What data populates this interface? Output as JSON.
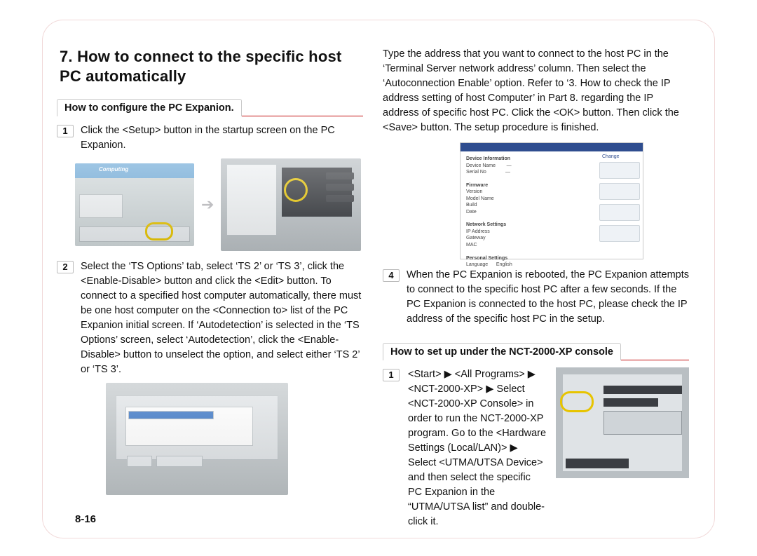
{
  "section_number": "7.",
  "section_title": "How to connect to the specific host PC automatically",
  "subheads": {
    "configure": "How to configure the PC Expanion.",
    "console": "How to set up under the NCT-2000-XP console"
  },
  "left": {
    "step1_num": "1",
    "step1": "Click the <Setup> button in the startup screen on the PC Expanion.",
    "step2_num": "2",
    "step2": "Select the ‘TS Options’ tab, select ‘TS 2’ or ‘TS 3’, click the <Enable-Disable> button and click the <Edit> button. To connect to a specified host computer automatically, there must be one host computer on the <Connection to> list of the PC Expanion initial screen. If ‘Autodetection’ is selected in the ‘TS Options’ screen, select ‘Autodetection’, click the <Enable-Disable> button to unselect the option, and select either ‘TS 2’ or ‘TS 3’."
  },
  "right": {
    "intro": "Type the address that you want to connect to the host PC in the ‘Terminal Server network address’ column. Then select the ‘Autoconnection Enable’ option. Refer to ‘3. How to check the IP address setting of host Computer’ in Part 8. regarding the IP address of specific host PC. Click the <OK> button. Then click the <Save> button. The setup procedure is finished.",
    "step4_num": "4",
    "step4": "When the PC Expanion is rebooted, the PC Expanion attempts to connect to the specific host PC after a few seconds. If the PC Expanion is connected to the host PC, please check the IP address of the specific host PC in the setup.",
    "console_step1_num": "1",
    "console_step1": "<Start> ▶ <All Programs> ▶ <NCT-2000-XP> ▶ Select <NCT-2000-XP Console> in order to run the NCT-2000-XP program. Go to the <Hardware Settings (Local/LAN)>  ▶ Select <UTMA/UTSA Device> and then select the specific PC Expanion in the “UTMA/UTSA list” and double-click it."
  },
  "page_footer": "8-16",
  "icons": {
    "arrow": "➔",
    "tri": "▶"
  },
  "shot_text": {
    "brand": "Computing",
    "device_info": "Device Information",
    "change": "Change"
  }
}
